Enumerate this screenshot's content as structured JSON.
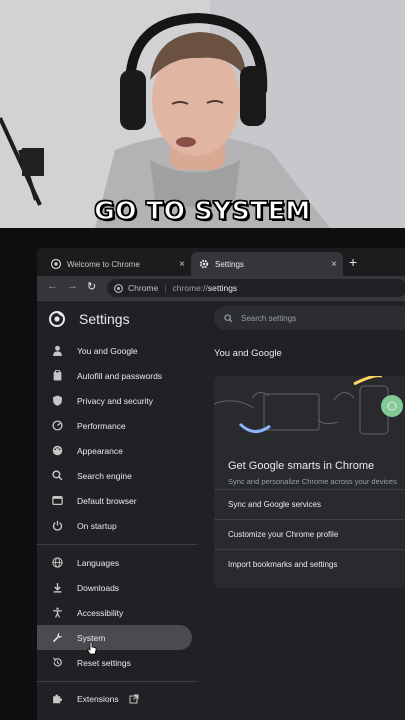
{
  "caption": "GO TO SYSTEM",
  "tabs": [
    {
      "label": "Welcome to Chrome",
      "close": "×",
      "icon": "chrome-icon"
    },
    {
      "label": "Settings",
      "close": "×",
      "icon": "gear-icon"
    }
  ],
  "new_tab": "+",
  "toolbar": {
    "back": "←",
    "forward": "→",
    "reload": "↻",
    "site": "Chrome",
    "url_prefix": "chrome://",
    "url_path": "settings"
  },
  "settings": {
    "title": "Settings",
    "search_placeholder": "Search settings",
    "sidebar": [
      {
        "label": "You and Google",
        "icon": "person-icon"
      },
      {
        "label": "Autofill and passwords",
        "icon": "clipboard-icon"
      },
      {
        "label": "Privacy and security",
        "icon": "shield-icon"
      },
      {
        "label": "Performance",
        "icon": "speedometer-icon"
      },
      {
        "label": "Appearance",
        "icon": "palette-icon"
      },
      {
        "label": "Search engine",
        "icon": "search-icon"
      },
      {
        "label": "Default browser",
        "icon": "browser-icon"
      },
      {
        "label": "On startup",
        "icon": "power-icon"
      },
      {
        "label": "Languages",
        "icon": "globe-icon"
      },
      {
        "label": "Downloads",
        "icon": "download-icon"
      },
      {
        "label": "Accessibility",
        "icon": "accessibility-icon"
      },
      {
        "label": "System",
        "icon": "wrench-icon"
      },
      {
        "label": "Reset settings",
        "icon": "reset-icon"
      },
      {
        "label": "Extensions",
        "icon": "puzzle-icon"
      }
    ],
    "section_title": "You and Google",
    "card": {
      "title": "Get Google smarts in Chrome",
      "subtitle": "Sync and personalize Chrome across your devices",
      "rows": [
        "Sync and Google services",
        "Customize your Chrome profile",
        "Import bookmarks and settings"
      ]
    }
  },
  "colors": {
    "accent_blue": "#8ab4f8",
    "accent_yellow": "#fdd663",
    "accent_green": "#81c995"
  }
}
